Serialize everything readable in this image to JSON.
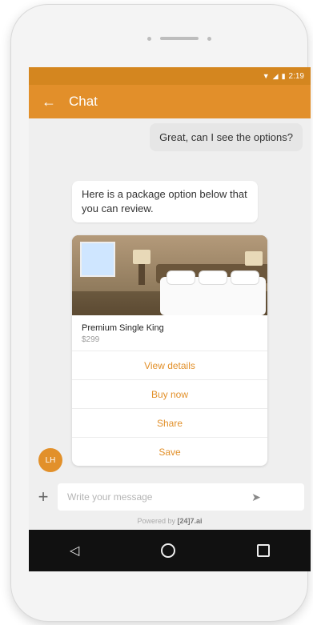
{
  "status": {
    "time": "2:19"
  },
  "app": {
    "title": "Chat"
  },
  "messages": {
    "user": "Great, can I see the options?",
    "bot": "Here is a package option below that you can review."
  },
  "card": {
    "name": "Premium Single King",
    "price": "$299",
    "actions": [
      "View details",
      "Buy now",
      "Share",
      "Save"
    ]
  },
  "avatar": {
    "initials": "LH"
  },
  "composer": {
    "placeholder": "Write your message"
  },
  "powered": {
    "prefix": "Powered by ",
    "brand": "[24]7.ai"
  },
  "colors": {
    "accent": "#e2902a",
    "statusbar": "#d4861f"
  },
  "icons": {
    "back": "back-arrow-icon",
    "plus": "plus-icon",
    "send": "send-icon",
    "nav_back": "nav-back-icon",
    "nav_home": "nav-home-icon",
    "nav_recent": "nav-recent-icon"
  }
}
